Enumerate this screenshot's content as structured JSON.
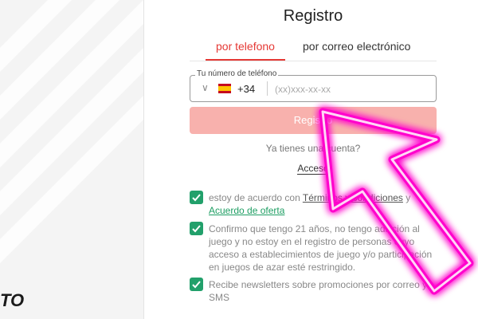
{
  "brand": {
    "logo_text": "TO"
  },
  "form": {
    "title": "Registro",
    "tabs": [
      {
        "label": "por telefono",
        "active": true
      },
      {
        "label": "por correo electrónico",
        "active": false
      }
    ],
    "phone": {
      "label": "Tu número de teléfono",
      "country_code": "+34",
      "placeholder": "(xx)xxx-xx-xx",
      "flag": "spain-flag-icon"
    },
    "register_button": "Registro",
    "have_account": "Ya tienes una cuenta?",
    "login_link": "Acceso",
    "checkboxes": [
      {
        "prefix": "estoy de acuerdo con ",
        "link1": "Términos y condiciones",
        "middle": " y ",
        "link2": "Acuerdo de oferta",
        "checked": true
      },
      {
        "text": "Confirmo que tengo 21 años, no tengo adicción al juego y no estoy en el registro de personas cuyo acceso a establecimientos de juego y/o participación en juegos de azar esté restringido.",
        "checked": true
      },
      {
        "text": "Recibe newsletters sobre promociones por correo y SMS",
        "checked": true
      }
    ]
  },
  "colors": {
    "accent": "#e53935",
    "button_disabled": "#f8b1ad",
    "checkbox": "#22a06b",
    "link_green": "#1e9e63",
    "arrow": "#ff00cc"
  }
}
